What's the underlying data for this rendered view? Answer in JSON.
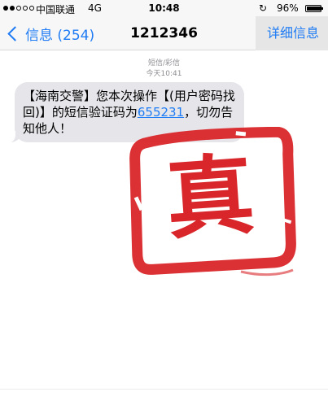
{
  "status_bar": {
    "carrier": "中国联通",
    "network": "4G",
    "time": "10:48",
    "battery_percent": "96%",
    "battery_level": 0.96,
    "signal_bars_filled": 2,
    "signal_bars_total": 5,
    "icons": [
      "signal-dots-icon",
      "rotation-lock-icon",
      "battery-icon"
    ]
  },
  "nav": {
    "back_label": "信息 (254)",
    "title": "1212346",
    "details_label": "详细信息",
    "accent_color": "#1f7cf4"
  },
  "conversation": {
    "message_type": "短信/彩信",
    "timestamp": "今天10:41",
    "message": {
      "text_before": "【海南交警】您本次操作【(用户密码找回)】的短信验证码为",
      "code": "655231",
      "text_after": "，切勿告知他人！",
      "bubble_color": "#e5e5ea"
    }
  },
  "stamp": {
    "character": "真",
    "color": "#d9262a"
  }
}
